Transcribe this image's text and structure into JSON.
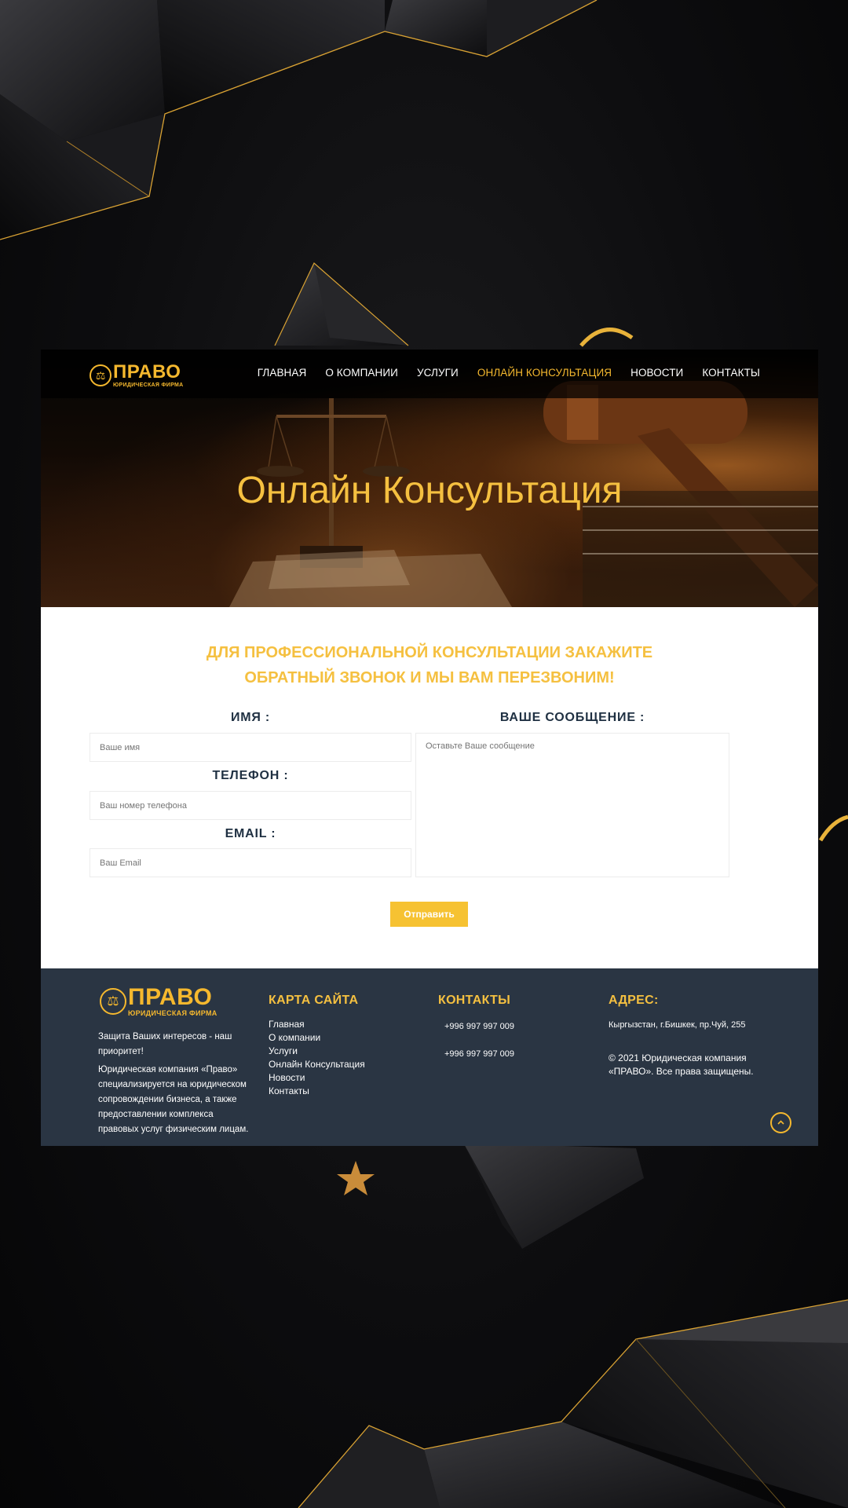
{
  "header": {
    "logo_title": "ПРАВО",
    "logo_subtitle": "ЮРИДИЧЕСКАЯ ФИРМА",
    "menu": [
      {
        "label": "ГЛАВНАЯ",
        "active": false
      },
      {
        "label": "О КОМПАНИИ",
        "active": false
      },
      {
        "label": "УСЛУГИ",
        "active": false
      },
      {
        "label": "ОНЛАЙН КОНСУЛЬТАЦИЯ",
        "active": true
      },
      {
        "label": "НОВОСТИ",
        "active": false
      },
      {
        "label": "КОНТАКТЫ",
        "active": false
      }
    ]
  },
  "hero": {
    "title": "Онлайн Консультация"
  },
  "form": {
    "heading_line1": "ДЛЯ ПРОФЕССИОНАЛЬНОЙ КОНСУЛЬТАЦИИ ЗАКАЖИТЕ",
    "heading_line2": "ОБРАТНЫЙ ЗВОНОК И МЫ ВАМ ПЕРЕЗВОНИМ!",
    "name_label": "ИМЯ :",
    "name_placeholder": "Ваше имя",
    "phone_label": "ТЕЛЕФОН :",
    "phone_placeholder": "Ваш номер телефона",
    "email_label": "EMAIL :",
    "email_placeholder": "Ваш Email",
    "message_label": "ВАШЕ СООБЩЕНИЕ :",
    "message_placeholder": "Оставьте Ваше сообщение",
    "submit_label": "Отправить"
  },
  "footer": {
    "logo_title": "ПРАВО",
    "logo_subtitle": "ЮРИДИЧЕСКАЯ ФИРМА",
    "tagline": "Защита Ваших интересов - наш приоритет!",
    "about": "Юридическая компания «Право» специализируется на юридическом сопровождении бизнеса, а также предоставлении комплекса правовых услуг физическим лицам.",
    "sitemap_heading": "КАРТА САЙТА",
    "sitemap": [
      "Главная",
      "О компании",
      "Услуги",
      "Онлайн Консультация",
      "Новости",
      "Контакты"
    ],
    "contacts_heading": "КОНТАКТЫ",
    "phone1": "+996 997 997 009",
    "phone2": "+996 997 997 009",
    "address_heading": "АДРЕС:",
    "address": "Кыргызстан, г.Бишкек, пр.Чуй, 255",
    "copyright": "© 2021 Юридическая компания «ПРАВО». Все права защищены."
  },
  "colors": {
    "accent": "#f5c040",
    "footer_bg": "#2a3543",
    "label_dark": "#1f3042"
  }
}
